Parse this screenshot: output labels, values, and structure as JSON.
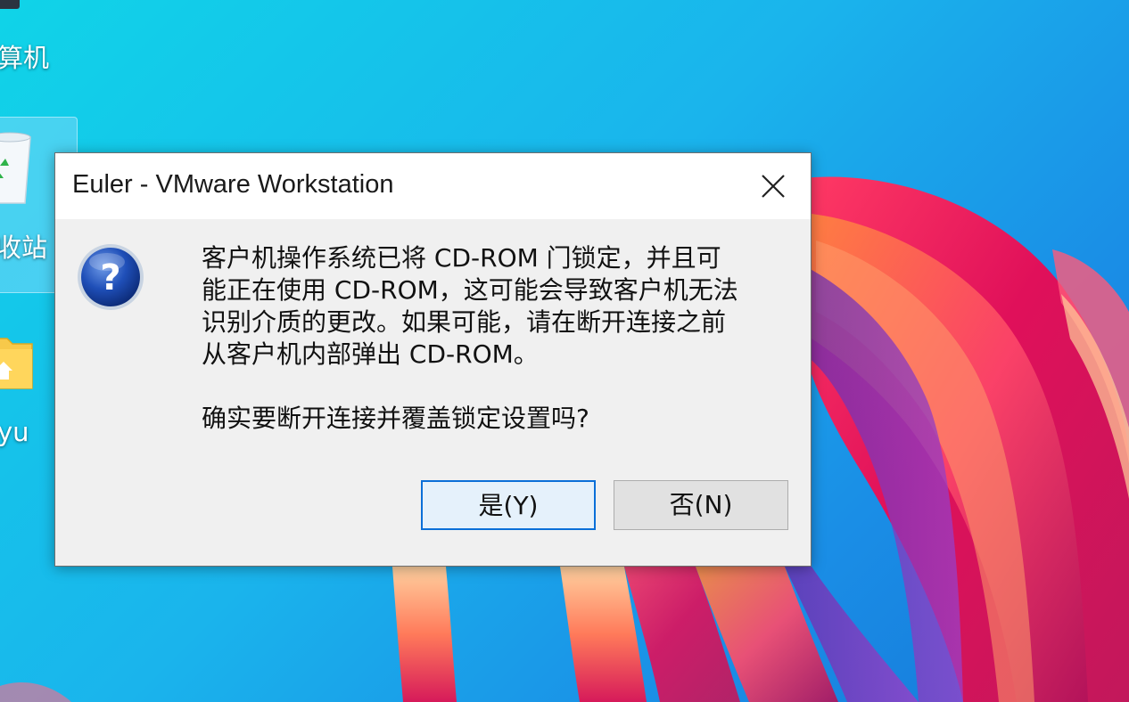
{
  "desktop": {
    "icons": [
      {
        "label": "算机",
        "icon": "computer-icon"
      },
      {
        "label": "收站",
        "icon": "recycle-bin-icon"
      },
      {
        "label": "yu",
        "icon": "folder-icon"
      }
    ]
  },
  "dialog": {
    "title": "Euler - VMware Workstation",
    "icon": "question-icon",
    "message_lines": [
      "客户机操作系统已将 CD-ROM 门锁定，并且可",
      "能正在使用 CD-ROM，这可能会导致客户机无法",
      "识别介质的更改。如果可能，请在断开连接之前",
      "从客户机内部弹出 CD-ROM。"
    ],
    "confirm": "确实要断开连接并覆盖锁定设置吗?",
    "yes_label": "是(Y)",
    "no_label": "否(N)",
    "close_icon": "close-icon"
  },
  "colors": {
    "desktop_bg": "#1ab4ec",
    "dialog_bg": "#f0f0f0",
    "accent": "#0a6fd8",
    "default_button_bg": "#e5f1fb"
  }
}
